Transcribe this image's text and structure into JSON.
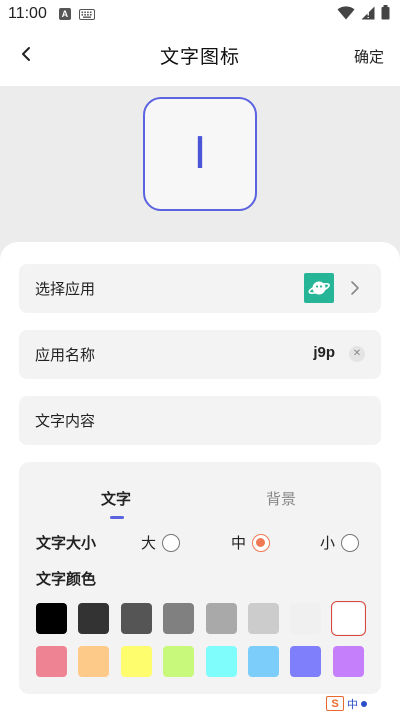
{
  "status_bar": {
    "time": "11:00",
    "notif_letter": "A"
  },
  "nav": {
    "title": "文字图标",
    "confirm_label": "确定"
  },
  "preview": {
    "text": "I",
    "border_color": "#5b63e0",
    "text_color": "#4b55d8"
  },
  "select_app": {
    "label": "选择应用",
    "app_icon": "planet-icon",
    "app_icon_color": "#27b597"
  },
  "app_name": {
    "label": "应用名称",
    "value": "j9p",
    "clear_symbol": "✕"
  },
  "text_content": {
    "label": "文字内容"
  },
  "tabs": [
    {
      "label": "文字",
      "active": true
    },
    {
      "label": "背景",
      "active": false
    }
  ],
  "text_size": {
    "label": "文字大小",
    "options": [
      {
        "label": "大",
        "selected": false
      },
      {
        "label": "中",
        "selected": true
      },
      {
        "label": "小",
        "selected": false
      }
    ],
    "accent_color": "#f07a55"
  },
  "text_color": {
    "label": "文字颜色",
    "swatches": [
      "#000000",
      "#333333",
      "#555555",
      "#808080",
      "#a9a9a9",
      "#cccccc",
      "#f0f0f0",
      "#ffffff",
      "#ee8393",
      "#fdca8a",
      "#fefd6e",
      "#c8f97a",
      "#7ffdfc",
      "#7dcdfa",
      "#7f7ffc",
      "#c67ffa"
    ],
    "selected_index": 7
  },
  "watermark": {
    "logo_letter": "S",
    "char": "中"
  }
}
